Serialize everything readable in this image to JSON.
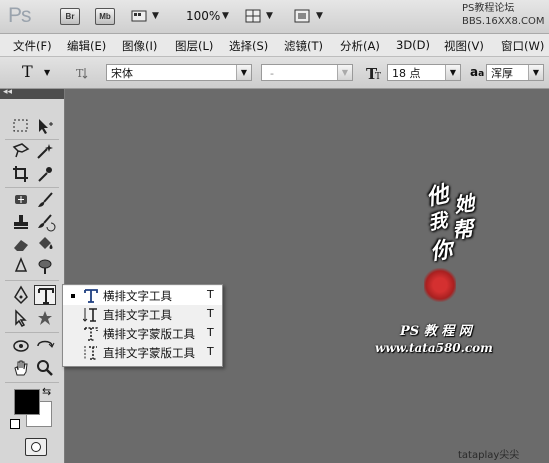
{
  "app": {
    "logo": "Ps",
    "bridge_label": "Br",
    "minibridge_label": "Mb",
    "zoom": "100%",
    "watermark_top_line1": "PS教程论坛",
    "watermark_top_line2": "BBS.16XX8.COM"
  },
  "menu": [
    "文件(F)",
    "编辑(E)",
    "图像(I)",
    "图层(L)",
    "选择(S)",
    "滤镜(T)",
    "分析(A)",
    "3D(D)",
    "视图(V)",
    "窗口(W)"
  ],
  "options": {
    "tool_glyph": "T",
    "font_family": "宋体",
    "font_style": "-",
    "font_size": "18 点",
    "aa_label": "a",
    "aa_mode": "浑厚"
  },
  "flyout": {
    "items": [
      {
        "label": "横排文字工具",
        "key": "T",
        "selected": true
      },
      {
        "label": "直排文字工具",
        "key": "T",
        "selected": false
      },
      {
        "label": "横排文字蒙版工具",
        "key": "T",
        "selected": false
      },
      {
        "label": "直排文字蒙版工具",
        "key": "T",
        "selected": false
      }
    ]
  },
  "artwork": {
    "chars": [
      "他",
      "她",
      "我",
      "帮",
      "你"
    ],
    "seal_text": "",
    "sig1": "PS 教 程 网",
    "sig2": "www.tata580.com"
  },
  "watermark_bottom": "tataplay尖尖",
  "colors": {
    "canvas": "#6b6b6b",
    "toolbox": "#d6d6d6",
    "foreground": "#000000",
    "background": "#ffffff"
  }
}
